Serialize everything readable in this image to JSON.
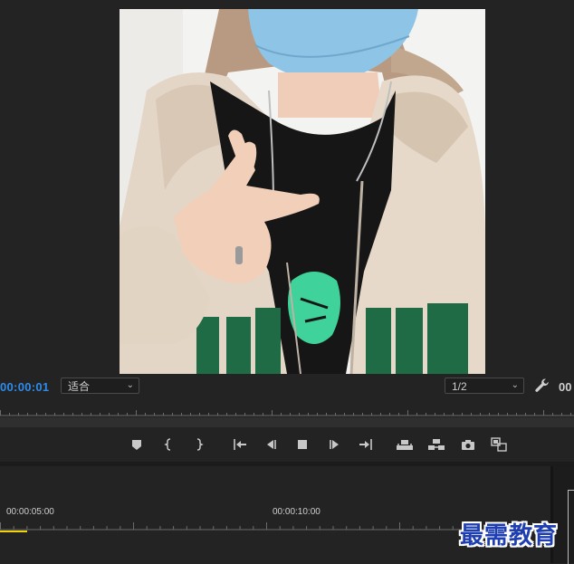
{
  "monitor": {
    "timecode": "00:00:01",
    "zoom": {
      "selected": "适合"
    },
    "resolution": {
      "selected": "1/2"
    },
    "duration": "00"
  },
  "transport": {
    "buttons": [
      {
        "name": "add-marker-button",
        "icon": "marker-icon"
      },
      {
        "name": "mark-in-button",
        "icon": "mark-in-icon"
      },
      {
        "name": "mark-out-button",
        "icon": "mark-out-icon"
      },
      {
        "name": "go-to-in-button",
        "icon": "go-to-in-icon"
      },
      {
        "name": "step-back-button",
        "icon": "step-back-icon"
      },
      {
        "name": "stop-button",
        "icon": "stop-icon"
      },
      {
        "name": "step-forward-button",
        "icon": "step-forward-icon"
      },
      {
        "name": "go-to-out-button",
        "icon": "go-to-out-icon"
      },
      {
        "name": "lift-button",
        "icon": "lift-icon"
      },
      {
        "name": "extract-button",
        "icon": "extract-icon"
      },
      {
        "name": "export-frame-button",
        "icon": "camera-icon"
      },
      {
        "name": "comparison-view-button",
        "icon": "comparison-icon"
      }
    ]
  },
  "timeline": {
    "ruler_labels": [
      "00:00:05:00",
      "00:00:10:00"
    ]
  },
  "watermark": {
    "text": "最需教育"
  },
  "colors": {
    "panel_bg": "#232323",
    "timecode_blue": "#2d8ceb",
    "work_area_yellow": "#f2d30a",
    "watermark_blue": "#1f3fb0"
  }
}
